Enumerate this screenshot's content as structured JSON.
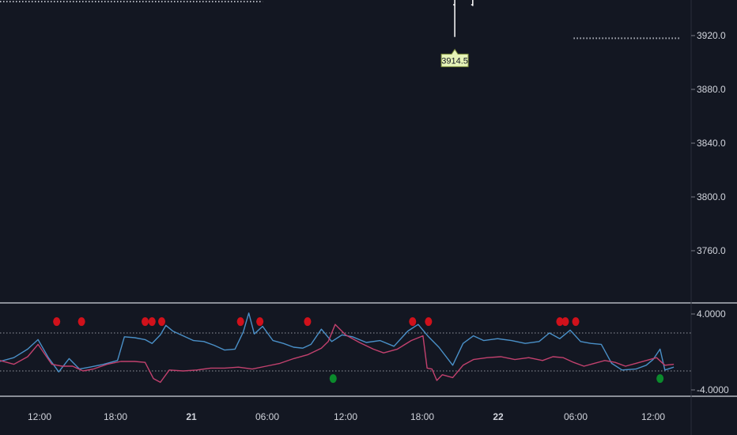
{
  "colors": {
    "background": "#131722",
    "axis_line": "#b2b5be",
    "dotted": "#b2b5be",
    "blue_series": "#4a90c8",
    "pink_series": "#c2416e",
    "sell_marker": "#d0111b",
    "buy_marker": "#0b8a2c",
    "callout_fill": "#e6f4b8",
    "text": "#d1d4dc"
  },
  "chart_data": [
    {
      "type": "line",
      "pane": "price",
      "y_ticks": [
        "3920.0",
        "3880.0",
        "3840.0",
        "3800.0",
        "3760.0"
      ],
      "ylim": [
        3730,
        3950
      ],
      "callout": {
        "label": "3914.5",
        "value": 3914.5
      },
      "candles": [
        {
          "t": 0.658,
          "low": 3919,
          "high": 3950
        },
        {
          "t": 0.684,
          "low": 3942,
          "high": 3950
        }
      ],
      "levels": [
        {
          "value": 3950,
          "t_from": 0.0,
          "t_to": 0.38
        },
        {
          "value": 3918,
          "t_from": 0.83,
          "t_to": 0.985
        }
      ]
    },
    {
      "type": "line",
      "pane": "oscillator",
      "y_ticks": [
        "4.0000",
        "-4.0000"
      ],
      "ylim": [
        -4.6,
        4.8
      ],
      "levels": [
        2.0,
        -2.0
      ],
      "x_ticks": [
        {
          "label": "12:00",
          "bold": false
        },
        {
          "label": "18:00",
          "bold": false
        },
        {
          "label": "21",
          "bold": true
        },
        {
          "label": "06:00",
          "bold": false
        },
        {
          "label": "12:00",
          "bold": false
        },
        {
          "label": "18:00",
          "bold": false
        },
        {
          "label": "22",
          "bold": true
        },
        {
          "label": "06:00",
          "bold": false
        },
        {
          "label": "12:00",
          "bold": false
        }
      ],
      "series": [
        {
          "color_key": "blue_series",
          "points": [
            [
              0,
              -1.0
            ],
            [
              0.02,
              -0.6
            ],
            [
              0.04,
              0.3
            ],
            [
              0.055,
              1.3
            ],
            [
              0.07,
              -0.6
            ],
            [
              0.085,
              -2.1
            ],
            [
              0.1,
              -0.7
            ],
            [
              0.115,
              -1.8
            ],
            [
              0.13,
              -1.6
            ],
            [
              0.15,
              -1.3
            ],
            [
              0.17,
              -0.9
            ],
            [
              0.18,
              1.6
            ],
            [
              0.195,
              1.5
            ],
            [
              0.21,
              1.3
            ],
            [
              0.22,
              0.9
            ],
            [
              0.232,
              1.8
            ],
            [
              0.24,
              2.8
            ],
            [
              0.25,
              2.2
            ],
            [
              0.265,
              1.7
            ],
            [
              0.28,
              1.2
            ],
            [
              0.295,
              1.1
            ],
            [
              0.31,
              0.7
            ],
            [
              0.325,
              0.2
            ],
            [
              0.34,
              0.3
            ],
            [
              0.352,
              2.1
            ],
            [
              0.36,
              4.1
            ],
            [
              0.368,
              1.9
            ],
            [
              0.38,
              2.7
            ],
            [
              0.395,
              1.2
            ],
            [
              0.41,
              0.9
            ],
            [
              0.425,
              0.5
            ],
            [
              0.438,
              0.4
            ],
            [
              0.45,
              0.8
            ],
            [
              0.465,
              2.4
            ],
            [
              0.48,
              1.1
            ],
            [
              0.495,
              1.8
            ],
            [
              0.51,
              1.6
            ],
            [
              0.53,
              1.0
            ],
            [
              0.55,
              1.2
            ],
            [
              0.57,
              0.6
            ],
            [
              0.59,
              2.2
            ],
            [
              0.605,
              2.9
            ],
            [
              0.62,
              1.6
            ],
            [
              0.635,
              0.5
            ],
            [
              0.655,
              -1.4
            ],
            [
              0.67,
              0.9
            ],
            [
              0.685,
              1.7
            ],
            [
              0.7,
              1.2
            ],
            [
              0.72,
              1.4
            ],
            [
              0.74,
              1.2
            ],
            [
              0.76,
              0.9
            ],
            [
              0.78,
              1.1
            ],
            [
              0.795,
              2.0
            ],
            [
              0.81,
              1.4
            ],
            [
              0.825,
              2.3
            ],
            [
              0.84,
              1.1
            ],
            [
              0.855,
              0.9
            ],
            [
              0.87,
              0.8
            ],
            [
              0.885,
              -1.2
            ],
            [
              0.9,
              -1.9
            ],
            [
              0.92,
              -1.8
            ],
            [
              0.935,
              -1.4
            ],
            [
              0.945,
              -0.8
            ],
            [
              0.955,
              0.3
            ],
            [
              0.962,
              -1.9
            ],
            [
              0.975,
              -1.6
            ]
          ]
        },
        {
          "color_key": "pink_series",
          "points": [
            [
              0,
              -0.9
            ],
            [
              0.02,
              -1.3
            ],
            [
              0.04,
              -0.5
            ],
            [
              0.055,
              0.8
            ],
            [
              0.075,
              -1.3
            ],
            [
              0.09,
              -1.5
            ],
            [
              0.105,
              -1.5
            ],
            [
              0.12,
              -2.0
            ],
            [
              0.135,
              -1.8
            ],
            [
              0.155,
              -1.3
            ],
            [
              0.175,
              -1.0
            ],
            [
              0.195,
              -1.0
            ],
            [
              0.21,
              -1.1
            ],
            [
              0.222,
              -2.8
            ],
            [
              0.232,
              -3.2
            ],
            [
              0.245,
              -1.9
            ],
            [
              0.265,
              -2.0
            ],
            [
              0.285,
              -1.9
            ],
            [
              0.305,
              -1.7
            ],
            [
              0.325,
              -1.7
            ],
            [
              0.345,
              -1.6
            ],
            [
              0.365,
              -1.8
            ],
            [
              0.385,
              -1.5
            ],
            [
              0.405,
              -1.2
            ],
            [
              0.425,
              -0.7
            ],
            [
              0.445,
              -0.3
            ],
            [
              0.465,
              0.4
            ],
            [
              0.475,
              1.1
            ],
            [
              0.485,
              2.9
            ],
            [
              0.5,
              1.8
            ],
            [
              0.52,
              1.0
            ],
            [
              0.54,
              0.3
            ],
            [
              0.555,
              -0.1
            ],
            [
              0.575,
              0.3
            ],
            [
              0.595,
              1.2
            ],
            [
              0.612,
              1.7
            ],
            [
              0.618,
              -1.7
            ],
            [
              0.625,
              -1.8
            ],
            [
              0.632,
              -3.0
            ],
            [
              0.64,
              -2.4
            ],
            [
              0.655,
              -2.7
            ],
            [
              0.67,
              -1.4
            ],
            [
              0.685,
              -0.8
            ],
            [
              0.705,
              -0.6
            ],
            [
              0.725,
              -0.5
            ],
            [
              0.745,
              -0.8
            ],
            [
              0.765,
              -0.6
            ],
            [
              0.785,
              -0.9
            ],
            [
              0.8,
              -0.5
            ],
            [
              0.815,
              -0.6
            ],
            [
              0.83,
              -1.1
            ],
            [
              0.845,
              -1.5
            ],
            [
              0.86,
              -1.2
            ],
            [
              0.875,
              -0.9
            ],
            [
              0.89,
              -1.1
            ],
            [
              0.905,
              -1.5
            ],
            [
              0.92,
              -1.2
            ],
            [
              0.935,
              -0.9
            ],
            [
              0.95,
              -0.6
            ],
            [
              0.962,
              -1.4
            ],
            [
              0.975,
              -1.3
            ]
          ]
        }
      ],
      "sell_markers": [
        [
          0.082,
          3.2
        ],
        [
          0.118,
          3.2
        ],
        [
          0.21,
          3.2
        ],
        [
          0.22,
          3.2
        ],
        [
          0.234,
          3.2
        ],
        [
          0.348,
          3.2
        ],
        [
          0.376,
          3.2
        ],
        [
          0.445,
          3.2
        ],
        [
          0.597,
          3.2
        ],
        [
          0.62,
          3.2
        ],
        [
          0.81,
          3.2
        ],
        [
          0.818,
          3.2
        ],
        [
          0.833,
          3.2
        ]
      ],
      "buy_markers": [
        [
          0.482,
          -2.8
        ],
        [
          0.955,
          -2.8
        ]
      ]
    }
  ]
}
